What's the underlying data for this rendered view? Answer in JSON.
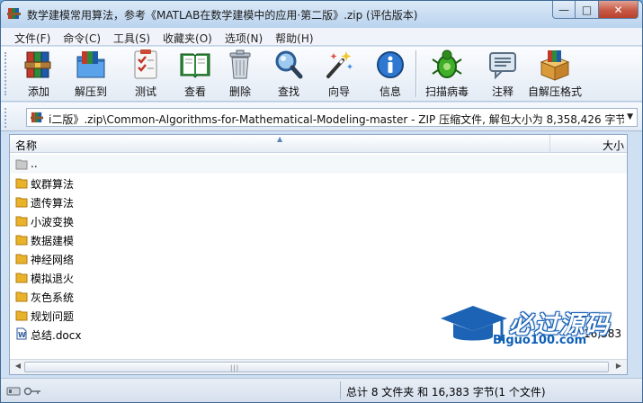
{
  "window": {
    "title": "数学建模常用算法，参考《MATLAB在数学建模中的应用·第二版》.zip (评估版本)",
    "minimize_glyph": "—",
    "maximize_glyph": "□",
    "close_glyph": "✕"
  },
  "menu": [
    {
      "label": "文件(F)"
    },
    {
      "label": "命令(C)"
    },
    {
      "label": "工具(S)"
    },
    {
      "label": "收藏夹(O)"
    },
    {
      "label": "选项(N)"
    },
    {
      "label": "帮助(H)"
    }
  ],
  "toolbar": {
    "buttons": [
      {
        "label": "添加",
        "icon": "books-stack-icon"
      },
      {
        "label": "解压到",
        "icon": "folder-extract-icon"
      },
      {
        "label": "测试",
        "icon": "checklist-icon"
      },
      {
        "label": "查看",
        "icon": "open-book-icon"
      },
      {
        "label": "删除",
        "icon": "trash-can-icon"
      },
      {
        "label": "查找",
        "icon": "magnifier-icon"
      },
      {
        "label": "向导",
        "icon": "magic-wand-icon"
      },
      {
        "label": "信息",
        "icon": "info-icon"
      },
      {
        "label": "扫描病毒",
        "icon": "bug-scan-icon"
      },
      {
        "label": "注释",
        "icon": "comment-icon"
      },
      {
        "label": "自解压格式",
        "icon": "sfx-box-icon"
      }
    ]
  },
  "address": {
    "path": "i二版》.zip\\Common-Algorithms-for-Mathematical-Modeling-master - ZIP 压缩文件, 解包大小为 8,358,426 字节"
  },
  "columns": {
    "name": "名称",
    "size": "大小"
  },
  "files": [
    {
      "name": "..",
      "type": "parent-folder",
      "size": ""
    },
    {
      "name": "蚁群算法",
      "type": "folder",
      "size": ""
    },
    {
      "name": "遗传算法",
      "type": "folder",
      "size": ""
    },
    {
      "name": "小波变换",
      "type": "folder",
      "size": ""
    },
    {
      "name": "数据建模",
      "type": "folder",
      "size": ""
    },
    {
      "name": "神经网络",
      "type": "folder",
      "size": ""
    },
    {
      "name": "模拟退火",
      "type": "folder",
      "size": ""
    },
    {
      "name": "灰色系统",
      "type": "folder",
      "size": ""
    },
    {
      "name": "规划问题",
      "type": "folder",
      "size": ""
    },
    {
      "name": "总结.docx",
      "type": "docx",
      "size": "16,383"
    }
  ],
  "status": {
    "summary": "总计 8 文件夹 和 16,383 字节(1 个文件)"
  },
  "watermark": {
    "title": "必过源码",
    "site": "Biguo100.com"
  },
  "colors": {
    "folder": "#e8b32a",
    "title_bar": "#b9d3ee",
    "close_button": "#c75a45",
    "watermark_blue": "#1c63b5"
  }
}
